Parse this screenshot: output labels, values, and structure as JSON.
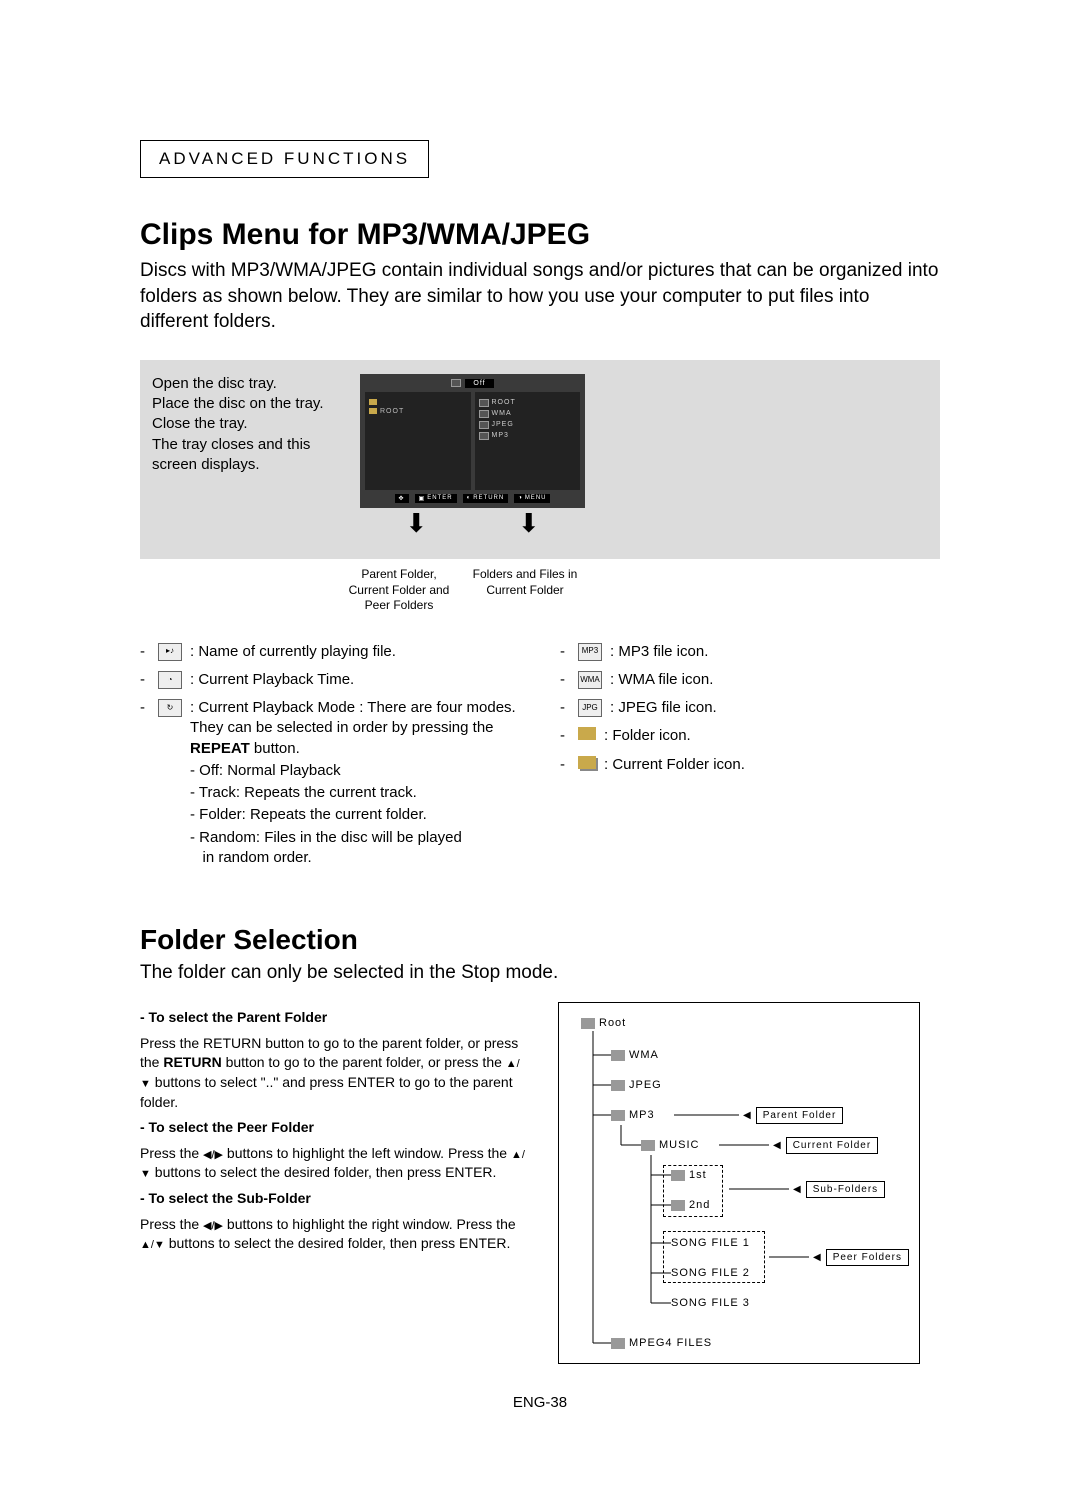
{
  "section_label": "ADVANCED FUNCTIONS",
  "heading1": "Clips Menu for MP3/WMA/JPEG",
  "intro": "Discs with MP3/WMA/JPEG contain individual songs and/or pictures that can be organized into folders as shown below.  They are similar to how you use your computer to put files into different folders.",
  "steps": "Open the disc tray.\nPlace the disc on the tray.\nClose the tray.\nThe tray closes and this screen displays.",
  "osd": {
    "off": "Off",
    "left_label": "ROOT",
    "right_items": [
      "ROOT",
      "WMA",
      "JPEG",
      "MP3"
    ],
    "foot": [
      "ENTER",
      "RETURN",
      "MENU"
    ]
  },
  "caption_left": "Parent Folder, Current Folder and Peer Folders",
  "caption_right": "Folders and Files in Current Folder",
  "legend_left": [
    {
      "icon": "play",
      "text": ": Name of currently playing file."
    },
    {
      "icon": "clock",
      "text": ": Current Playback Time."
    },
    {
      "icon": "repeat",
      "text": ": Current Playback Mode : There are four modes. They can be selected in order by pressing the REPEAT button.",
      "sub": [
        "- Off: Normal Playback",
        "- Track: Repeats the current track.",
        "- Folder: Repeats the current folder.",
        "- Random: Files in the disc will be played in random order."
      ]
    }
  ],
  "legend_right": [
    {
      "icon": "MP3",
      "text": ": MP3 file icon."
    },
    {
      "icon": "WMA",
      "text": ": WMA file icon."
    },
    {
      "icon": "JPG",
      "text": ": JPEG file icon."
    },
    {
      "icon": "folder",
      "text": ": Folder icon."
    },
    {
      "icon": "cfolder",
      "text": ": Current Folder icon."
    }
  ],
  "heading2": "Folder Selection",
  "sub_intro": "The folder can only be selected in the Stop mode.",
  "folder_text": {
    "h1": "- To select the Parent Folder",
    "p1a": "Press the RETURN button to go to the parent folder, or press the ",
    "p1b": " buttons to select \"..\" and press ENTER to go to the parent folder.",
    "h2": "- To select the Peer Folder",
    "p2a": "Press the ",
    "p2b": " buttons to highlight the left window. Press the ",
    "p2c": " buttons to select the desired folder, then press ENTER.",
    "h3": "- To select the Sub-Folder",
    "p3a": "Press the ",
    "p3b": " buttons to highlight the right window. Press the ",
    "p3c": " buttons to select the desired folder, then press ENTER."
  },
  "tree": {
    "root": "Root",
    "wma": "WMA",
    "jpeg": "JPEG",
    "mp3": "MP3",
    "music": "MUSIC",
    "first": "1st",
    "second": "2nd",
    "song1": "SONG FILE 1",
    "song2": "SONG FILE 2",
    "song3": "SONG FILE 3",
    "mpeg4": "MPEG4 FILES",
    "parent": "Parent Folder",
    "current": "Current Folder",
    "sub": "Sub-Folders",
    "peer": "Peer Folders"
  },
  "page_num": "ENG-38"
}
